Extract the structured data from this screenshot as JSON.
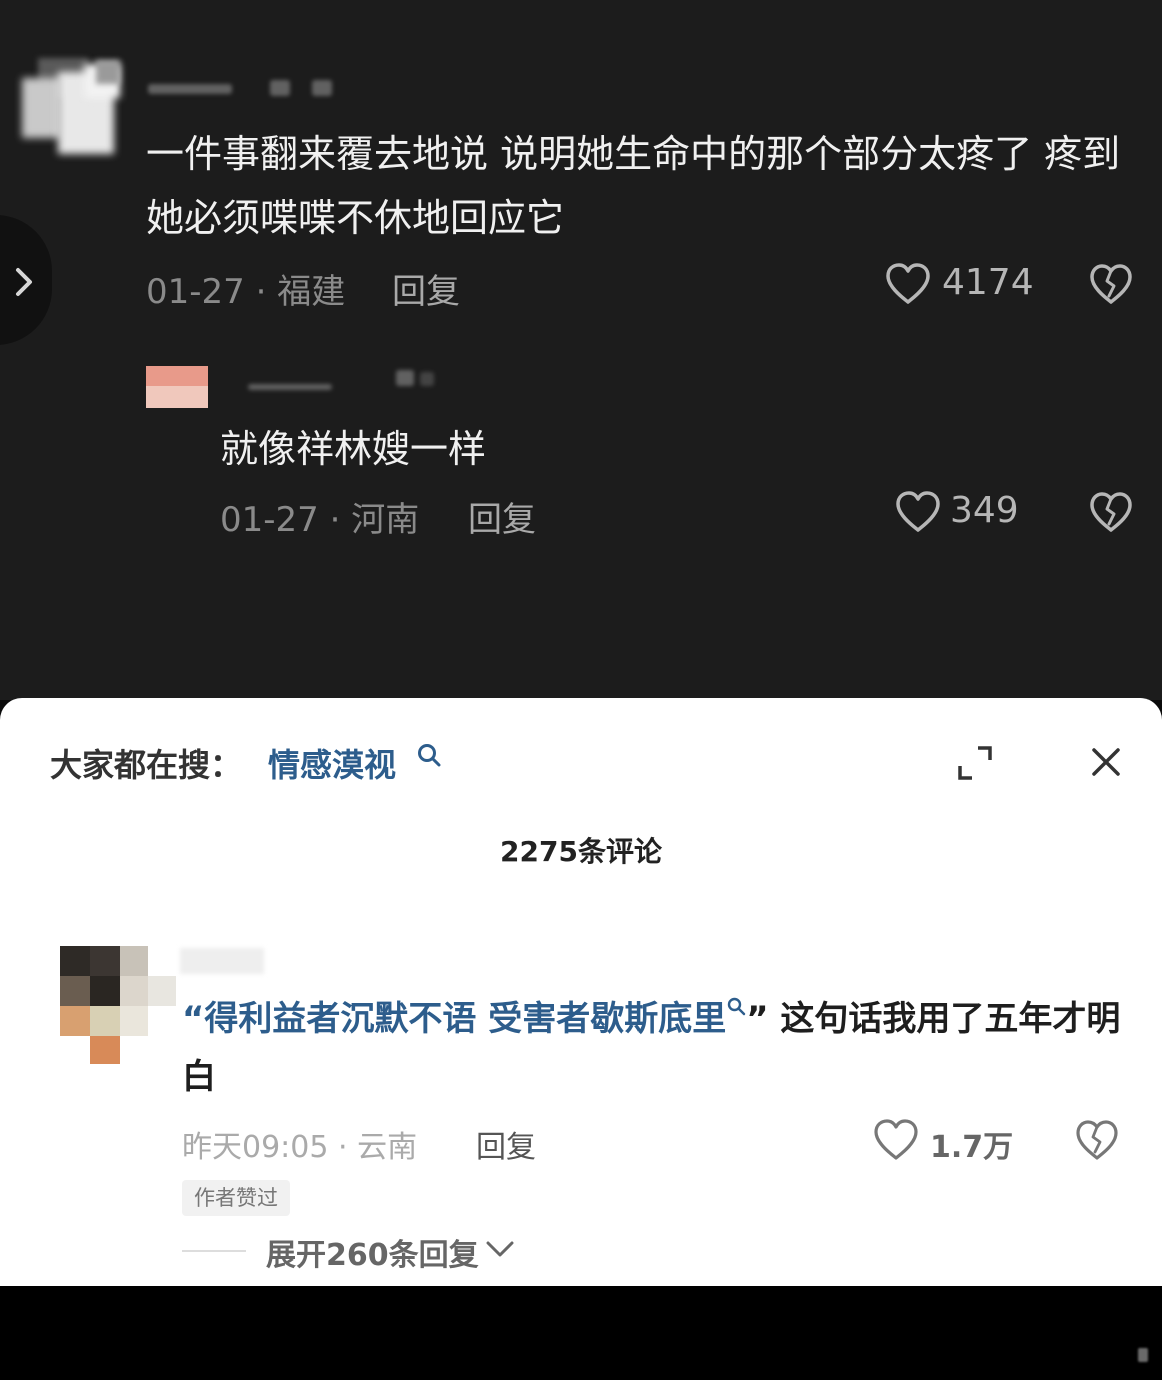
{
  "comment1": {
    "text": "一件事翻来覆去地说 说明她生命中的那个部分太疼了  疼到她必须喋喋不休地回应它",
    "meta": "01-27 · 福建",
    "reply_label": "回复",
    "likes": "4174"
  },
  "comment2": {
    "text": "就像祥林嫂一样",
    "meta": "01-27 · 河南",
    "reply_label": "回复",
    "likes": "349"
  },
  "sheet": {
    "search_label": "大家都在搜：",
    "search_term": "情感漠视",
    "comment_count_title": "2275条评论"
  },
  "comment3": {
    "quote_open": "“",
    "quote_text": "得利益者沉默不语 受害者歇斯底里",
    "quote_close": "”",
    "text_rest": "  这句话我用了五年才明白",
    "meta": "昨天09:05 · 云南",
    "reply_label": "回复",
    "likes": "1.7万",
    "author_badge": "作者赞过",
    "expand_replies": "展开260条回复"
  },
  "colors": {
    "dark_bg": "#1c1c1c",
    "sheet_bg": "#ffffff",
    "link_blue": "#2d5d8c"
  },
  "icons": [
    "chevron-right-icon",
    "heart-icon",
    "broken-heart-icon",
    "search-icon",
    "expand-icon",
    "close-icon",
    "chevron-down-icon"
  ]
}
